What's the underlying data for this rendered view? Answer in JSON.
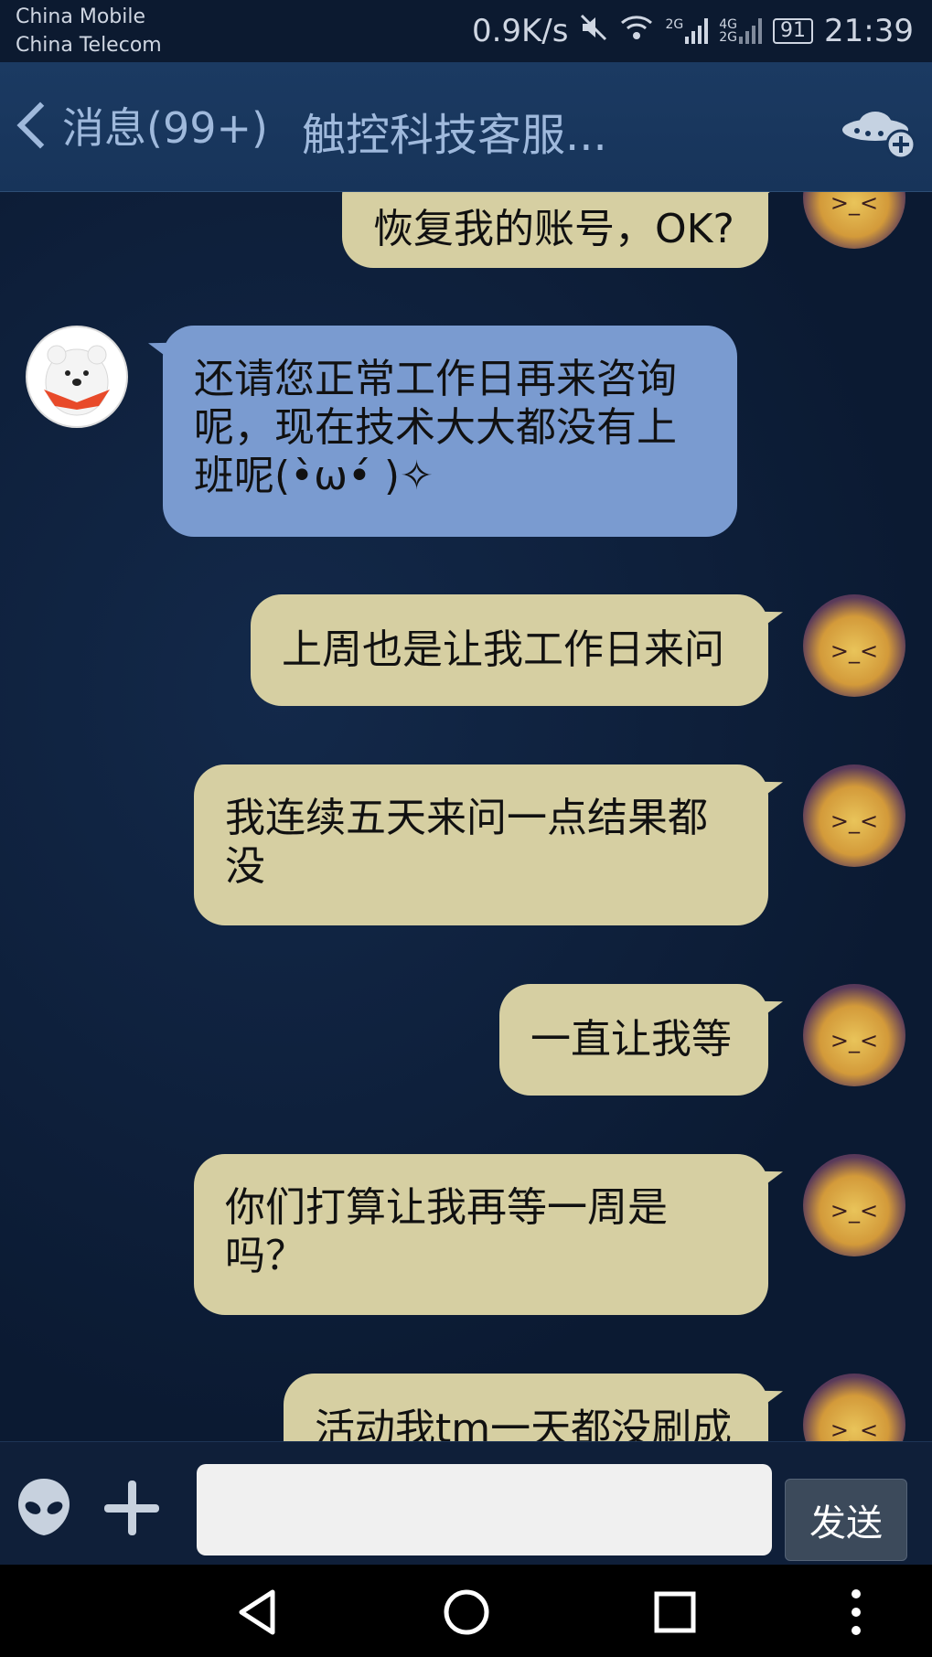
{
  "status_bar": {
    "carrier_1": "China Mobile",
    "carrier_2": "China Telecom",
    "net_speed": "0.9K/s",
    "sim1_type": "2G",
    "sim2_type_top": "4G",
    "sim2_type_bottom": "2G",
    "battery": "91",
    "time": "21:39"
  },
  "header": {
    "back_label": "消息(99+)",
    "title": "触控科技客服..."
  },
  "messages": [
    {
      "side": "me",
      "text": "恢复我的账号，OK?"
    },
    {
      "side": "other",
      "lines": [
        "还请您正常工作日再来咨询",
        "呢，现在技术大大都没有上",
        "班呢(•̀ω•́ )✧"
      ]
    },
    {
      "side": "me",
      "text": "上周也是让我工作日来问"
    },
    {
      "side": "me",
      "lines": [
        "我连续五天来问一点结果都",
        "没"
      ]
    },
    {
      "side": "me",
      "text": "一直让我等"
    },
    {
      "side": "me",
      "lines": [
        "你们打算让我再等一周是",
        "吗？"
      ]
    },
    {
      "side": "me",
      "text": "活动我tm一天都没刷成"
    }
  ],
  "input": {
    "placeholder": "",
    "send_label": "发送"
  },
  "colors": {
    "background": "#0c1a30",
    "header": "#1b3a62",
    "my_bubble": "#d6cfa2",
    "their_bubble": "#7a9bd0",
    "send_button": "#3c4a5b"
  },
  "icons": [
    "back-chevron-icon",
    "ufo-add-icon",
    "alien-emoji-icon",
    "plus-icon",
    "nav-back-icon",
    "nav-home-icon",
    "nav-recents-icon",
    "nav-menu-icon"
  ]
}
